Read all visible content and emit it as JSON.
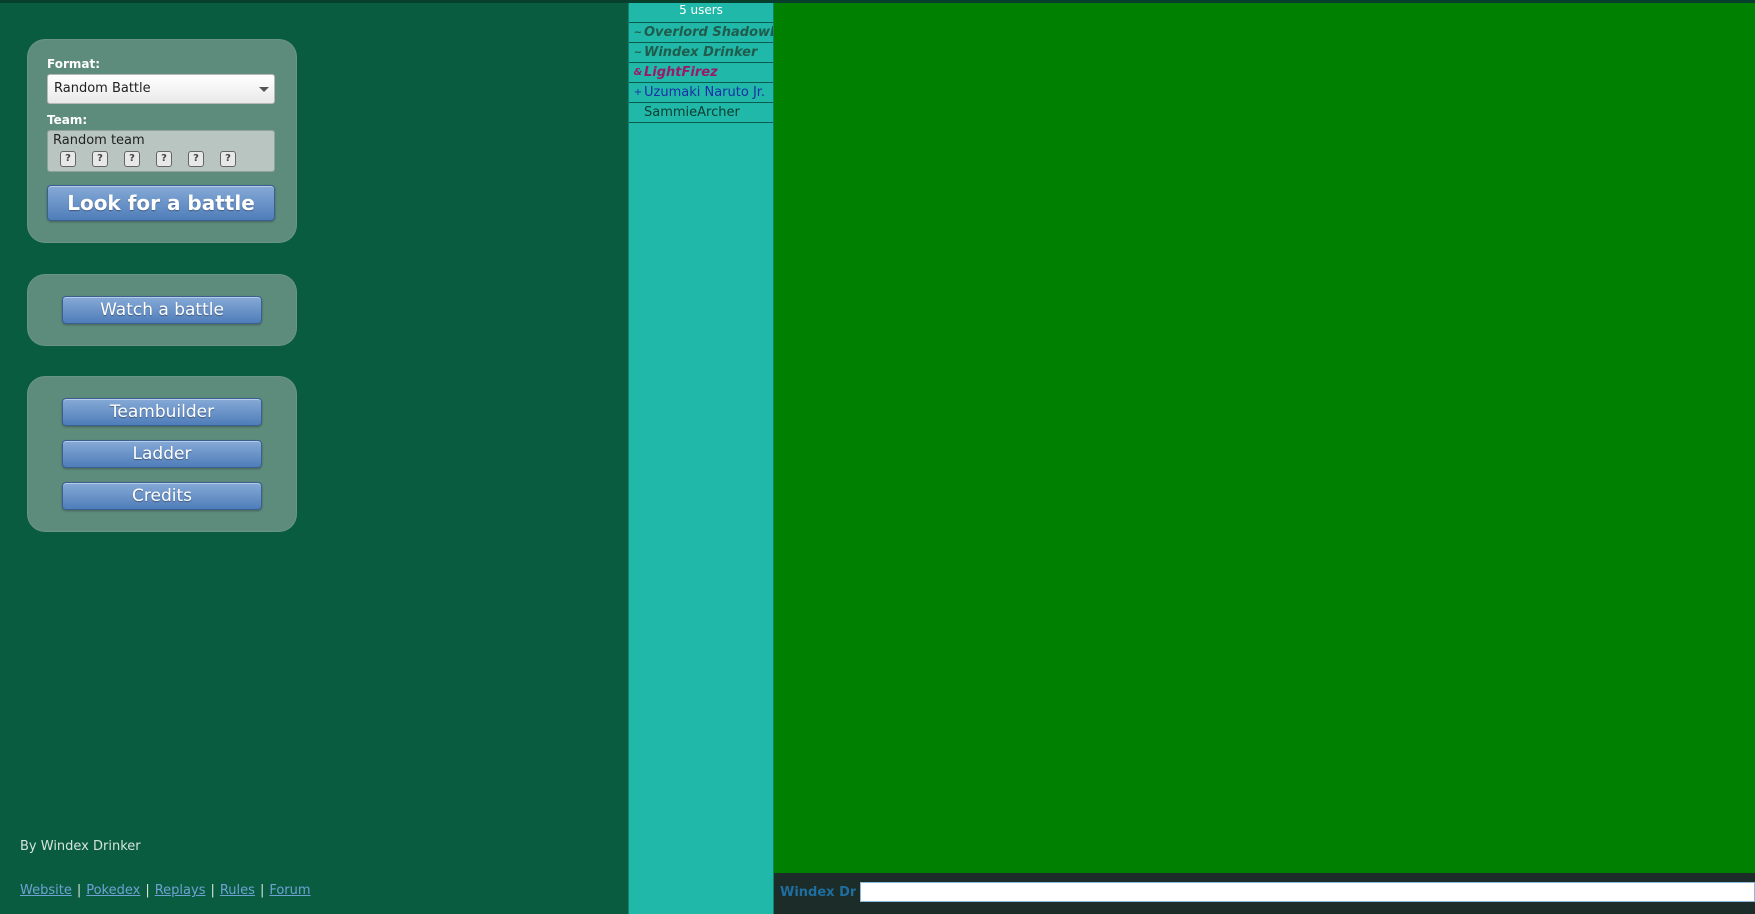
{
  "main_menu": {
    "format_label": "Format:",
    "format_value": "Random Battle",
    "team_label": "Team:",
    "team_value": "Random team",
    "team_slot_icon": "?",
    "look_for_battle_label": "Look for a battle",
    "watch_battle_label": "Watch a battle",
    "teambuilder_label": "Teambuilder",
    "ladder_label": "Ladder",
    "credits_label": "Credits"
  },
  "footer": {
    "by_line": "By Windex Drinker",
    "links": [
      "Website",
      "Pokedex",
      "Replays",
      "Rules",
      "Forum"
    ],
    "separator": "|"
  },
  "userlist": {
    "count_label": "5 users",
    "users": [
      {
        "rank": "~",
        "name": "Overlord ShadowL",
        "color": "#1f5c4d"
      },
      {
        "rank": "~",
        "name": "Windex Drinker",
        "color": "#1f5c4d"
      },
      {
        "rank": "&",
        "name": "LightFirez",
        "color": "#9a1a6a"
      },
      {
        "rank": "+",
        "name": "Uzumaki Naruto Jr.",
        "color": "#1a2ea8"
      },
      {
        "rank": "",
        "name": "SammieArcher",
        "color": "#0d3d30"
      }
    ]
  },
  "chat": {
    "username": "Windex Drinker",
    "input_value": ""
  },
  "colors": {
    "left_bg": "#0a5c40",
    "userlist_bg": "#20b8a8",
    "chat_bg": "#008000",
    "button_blue": "#5c88c2"
  }
}
